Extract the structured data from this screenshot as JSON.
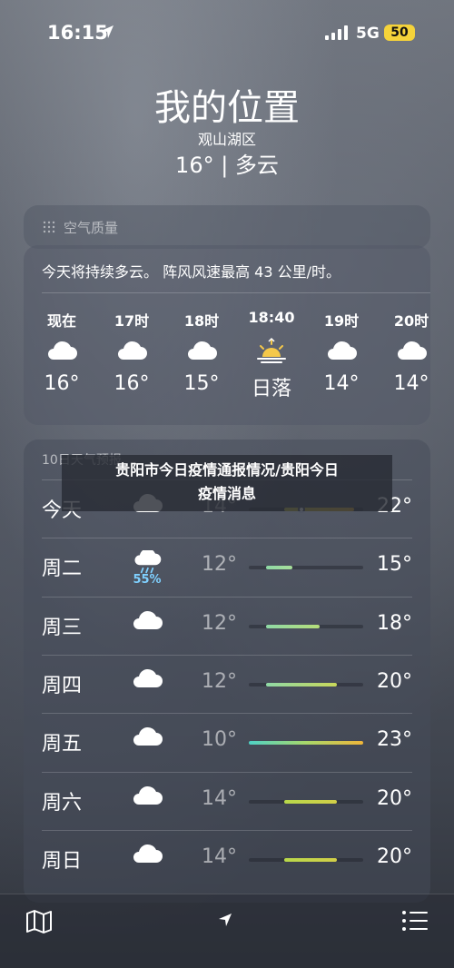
{
  "status_bar": {
    "time": "16:15",
    "network": "5G",
    "battery": "50",
    "icons": [
      "location-arrow-icon",
      "signal-icon",
      "battery-icon"
    ]
  },
  "header": {
    "city": "我的位置",
    "area": "观山湖区",
    "current": "16° | 多云"
  },
  "air_quality": {
    "label": "空气质量",
    "icon": "air-quality-icon"
  },
  "hourly": {
    "summary": "今天将持续多云。 阵风风速最高 43 公里/时。",
    "items": [
      {
        "time": "现在",
        "icon": "cloud-icon",
        "temp": "16°"
      },
      {
        "time": "17时",
        "icon": "cloud-icon",
        "temp": "16°"
      },
      {
        "time": "18时",
        "icon": "cloud-icon",
        "temp": "15°"
      },
      {
        "time": "18:40",
        "icon": "sunset-icon",
        "temp": "日落"
      },
      {
        "time": "19时",
        "icon": "cloud-icon",
        "temp": "14°"
      },
      {
        "time": "20时",
        "icon": "cloud-icon",
        "temp": "14°"
      }
    ]
  },
  "daily": {
    "heading": "10日天气预报",
    "range_min": 10,
    "range_max": 23,
    "rows": [
      {
        "day": "今天",
        "icon": "cloud-icon",
        "pop": "",
        "low": "14°",
        "high": "22°",
        "low_val": 14,
        "high_val": 22,
        "current": 16,
        "grad": "linear-gradient(90deg,#c9c64a,#e2b23a)"
      },
      {
        "day": "周二",
        "icon": "rain-cloud-icon",
        "pop": "55%",
        "low": "12°",
        "high": "15°",
        "low_val": 12,
        "high_val": 15,
        "grad": "linear-gradient(90deg,#8fd9a6,#a8df9a)"
      },
      {
        "day": "周三",
        "icon": "cloud-icon",
        "pop": "",
        "low": "12°",
        "high": "18°",
        "low_val": 12,
        "high_val": 18,
        "grad": "linear-gradient(90deg,#8fd9a6,#b6de7a)"
      },
      {
        "day": "周四",
        "icon": "cloud-icon",
        "pop": "",
        "low": "12°",
        "high": "20°",
        "low_val": 12,
        "high_val": 20,
        "grad": "linear-gradient(90deg,#8fd9a6,#c9d85a)"
      },
      {
        "day": "周五",
        "icon": "cloud-icon",
        "pop": "",
        "low": "10°",
        "high": "23°",
        "low_val": 10,
        "high_val": 23,
        "grad": "linear-gradient(90deg,#4fd1c5,#a8d86a,#f0b63a)"
      },
      {
        "day": "周六",
        "icon": "cloud-icon",
        "pop": "",
        "low": "14°",
        "high": "20°",
        "low_val": 14,
        "high_val": 20,
        "grad": "linear-gradient(90deg,#b8d84a,#d2cf48)"
      },
      {
        "day": "周日",
        "icon": "cloud-icon",
        "pop": "",
        "low": "14°",
        "high": "20°",
        "low_val": 14,
        "high_val": 20,
        "grad": "linear-gradient(90deg,#b8d84a,#d2cf48)"
      }
    ]
  },
  "banner": {
    "line1": "贵阳市今日疫情通报情况/贵阳今日",
    "line2": "疫情消息"
  },
  "bottom_bar": {
    "icons": [
      "map-icon",
      "location-arrow-icon",
      "list-icon"
    ]
  }
}
